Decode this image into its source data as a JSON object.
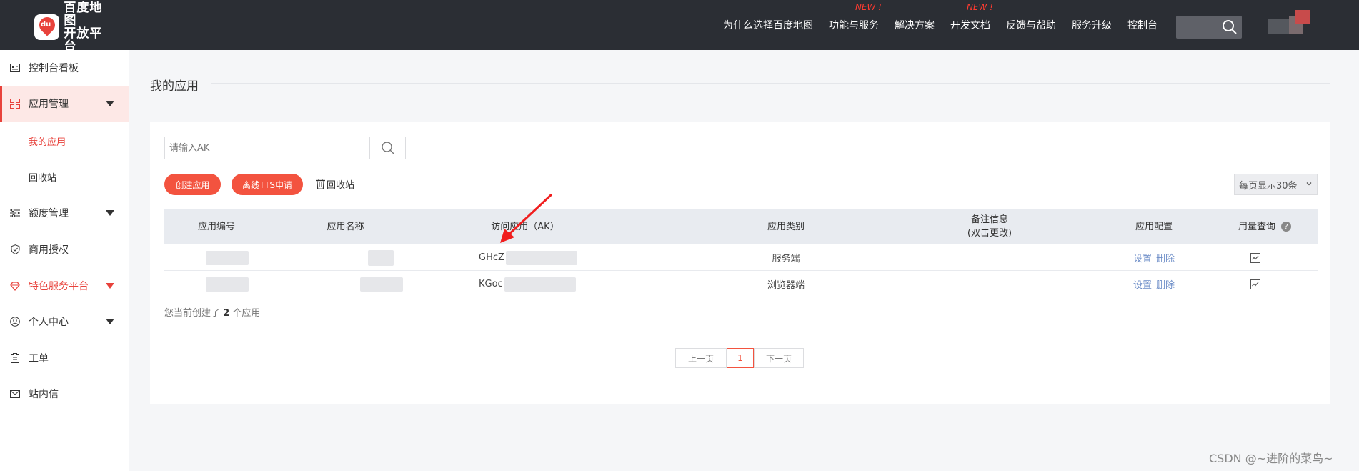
{
  "brand": {
    "badge_text": "du",
    "name": "百度地图\n开放平台"
  },
  "nav": {
    "items": [
      {
        "label": "为什么选择百度地图",
        "new": ""
      },
      {
        "label": "功能与服务",
        "new": "NEW !"
      },
      {
        "label": "解决方案",
        "new": ""
      },
      {
        "label": "开发文档",
        "new": "NEW !"
      },
      {
        "label": "反馈与帮助",
        "new": ""
      },
      {
        "label": "服务升级",
        "new": ""
      },
      {
        "label": "控制台",
        "new": ""
      }
    ]
  },
  "sidebar": {
    "items": [
      {
        "label": "控制台看板",
        "icon": "dashboard-card-icon"
      },
      {
        "label": "应用管理",
        "icon": "grid-apps-icon"
      },
      {
        "label": "额度管理",
        "icon": "sliders-icon"
      },
      {
        "label": "商用授权",
        "icon": "shield-check-icon"
      },
      {
        "label": "特色服务平台",
        "icon": "heart-diamond-icon"
      },
      {
        "label": "个人中心",
        "icon": "user-circle-icon"
      },
      {
        "label": "工单",
        "icon": "clipboard-icon"
      },
      {
        "label": "站内信",
        "icon": "mail-icon"
      }
    ],
    "sub_items": [
      {
        "label": "我的应用"
      },
      {
        "label": "回收站"
      }
    ]
  },
  "main": {
    "title": "我的应用",
    "search_placeholder": "请输入AK",
    "create_button": "创建应用",
    "tts_button": "离线TTS申请",
    "recycle_label": "回收站",
    "page_size": "每页显示30条",
    "count_prefix": "您当前创建了",
    "count_value": "2",
    "count_suffix": "个应用"
  },
  "table": {
    "headers": {
      "id": "应用编号",
      "name": "应用名称",
      "ak": "访问应用（AK）",
      "type": "应用类别",
      "note_line1": "备注信息",
      "note_line2": "(双击更改)",
      "config": "应用配置",
      "usage": "用量查询"
    },
    "rows": [
      {
        "ak_prefix": "GHcZ",
        "type": "服务端",
        "set": "设置",
        "delete": "删除"
      },
      {
        "ak_prefix": "KGoc",
        "type": "浏览器端",
        "set": "设置",
        "delete": "删除"
      }
    ]
  },
  "pager": {
    "prev": "上一页",
    "current": "1",
    "next": "下一页"
  },
  "watermark": "CSDN @~进阶的菜鸟~",
  "colors": {
    "accent": "#e8423b",
    "button": "#f3533f",
    "topbar": "#2b2e34",
    "link": "#6b8cc7"
  }
}
